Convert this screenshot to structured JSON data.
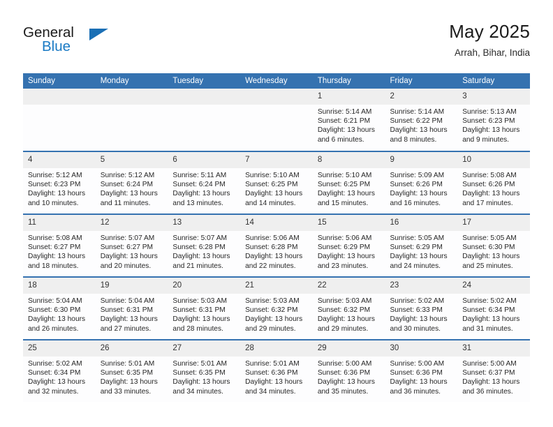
{
  "brand": {
    "name_part1": "General",
    "name_part2": "Blue",
    "triangle_color": "#1a6fb5",
    "blue_text_color": "#1a7ac4"
  },
  "header": {
    "title": "May 2025",
    "location": "Arrah, Bihar, India"
  },
  "theme": {
    "header_blue": "#3572b0",
    "daynum_band": "#efefef",
    "cell_background": "#fdfdfe",
    "text": "#262626"
  },
  "weekdays": [
    "Sunday",
    "Monday",
    "Tuesday",
    "Wednesday",
    "Thursday",
    "Friday",
    "Saturday"
  ],
  "weeks": [
    [
      {
        "day": "",
        "sunrise": "",
        "sunset": "",
        "daylight": ""
      },
      {
        "day": "",
        "sunrise": "",
        "sunset": "",
        "daylight": ""
      },
      {
        "day": "",
        "sunrise": "",
        "sunset": "",
        "daylight": ""
      },
      {
        "day": "",
        "sunrise": "",
        "sunset": "",
        "daylight": ""
      },
      {
        "day": "1",
        "sunrise": "Sunrise: 5:14 AM",
        "sunset": "Sunset: 6:21 PM",
        "daylight": "Daylight: 13 hours and 6 minutes."
      },
      {
        "day": "2",
        "sunrise": "Sunrise: 5:14 AM",
        "sunset": "Sunset: 6:22 PM",
        "daylight": "Daylight: 13 hours and 8 minutes."
      },
      {
        "day": "3",
        "sunrise": "Sunrise: 5:13 AM",
        "sunset": "Sunset: 6:23 PM",
        "daylight": "Daylight: 13 hours and 9 minutes."
      }
    ],
    [
      {
        "day": "4",
        "sunrise": "Sunrise: 5:12 AM",
        "sunset": "Sunset: 6:23 PM",
        "daylight": "Daylight: 13 hours and 10 minutes."
      },
      {
        "day": "5",
        "sunrise": "Sunrise: 5:12 AM",
        "sunset": "Sunset: 6:24 PM",
        "daylight": "Daylight: 13 hours and 11 minutes."
      },
      {
        "day": "6",
        "sunrise": "Sunrise: 5:11 AM",
        "sunset": "Sunset: 6:24 PM",
        "daylight": "Daylight: 13 hours and 13 minutes."
      },
      {
        "day": "7",
        "sunrise": "Sunrise: 5:10 AM",
        "sunset": "Sunset: 6:25 PM",
        "daylight": "Daylight: 13 hours and 14 minutes."
      },
      {
        "day": "8",
        "sunrise": "Sunrise: 5:10 AM",
        "sunset": "Sunset: 6:25 PM",
        "daylight": "Daylight: 13 hours and 15 minutes."
      },
      {
        "day": "9",
        "sunrise": "Sunrise: 5:09 AM",
        "sunset": "Sunset: 6:26 PM",
        "daylight": "Daylight: 13 hours and 16 minutes."
      },
      {
        "day": "10",
        "sunrise": "Sunrise: 5:08 AM",
        "sunset": "Sunset: 6:26 PM",
        "daylight": "Daylight: 13 hours and 17 minutes."
      }
    ],
    [
      {
        "day": "11",
        "sunrise": "Sunrise: 5:08 AM",
        "sunset": "Sunset: 6:27 PM",
        "daylight": "Daylight: 13 hours and 18 minutes."
      },
      {
        "day": "12",
        "sunrise": "Sunrise: 5:07 AM",
        "sunset": "Sunset: 6:27 PM",
        "daylight": "Daylight: 13 hours and 20 minutes."
      },
      {
        "day": "13",
        "sunrise": "Sunrise: 5:07 AM",
        "sunset": "Sunset: 6:28 PM",
        "daylight": "Daylight: 13 hours and 21 minutes."
      },
      {
        "day": "14",
        "sunrise": "Sunrise: 5:06 AM",
        "sunset": "Sunset: 6:28 PM",
        "daylight": "Daylight: 13 hours and 22 minutes."
      },
      {
        "day": "15",
        "sunrise": "Sunrise: 5:06 AM",
        "sunset": "Sunset: 6:29 PM",
        "daylight": "Daylight: 13 hours and 23 minutes."
      },
      {
        "day": "16",
        "sunrise": "Sunrise: 5:05 AM",
        "sunset": "Sunset: 6:29 PM",
        "daylight": "Daylight: 13 hours and 24 minutes."
      },
      {
        "day": "17",
        "sunrise": "Sunrise: 5:05 AM",
        "sunset": "Sunset: 6:30 PM",
        "daylight": "Daylight: 13 hours and 25 minutes."
      }
    ],
    [
      {
        "day": "18",
        "sunrise": "Sunrise: 5:04 AM",
        "sunset": "Sunset: 6:30 PM",
        "daylight": "Daylight: 13 hours and 26 minutes."
      },
      {
        "day": "19",
        "sunrise": "Sunrise: 5:04 AM",
        "sunset": "Sunset: 6:31 PM",
        "daylight": "Daylight: 13 hours and 27 minutes."
      },
      {
        "day": "20",
        "sunrise": "Sunrise: 5:03 AM",
        "sunset": "Sunset: 6:31 PM",
        "daylight": "Daylight: 13 hours and 28 minutes."
      },
      {
        "day": "21",
        "sunrise": "Sunrise: 5:03 AM",
        "sunset": "Sunset: 6:32 PM",
        "daylight": "Daylight: 13 hours and 29 minutes."
      },
      {
        "day": "22",
        "sunrise": "Sunrise: 5:03 AM",
        "sunset": "Sunset: 6:32 PM",
        "daylight": "Daylight: 13 hours and 29 minutes."
      },
      {
        "day": "23",
        "sunrise": "Sunrise: 5:02 AM",
        "sunset": "Sunset: 6:33 PM",
        "daylight": "Daylight: 13 hours and 30 minutes."
      },
      {
        "day": "24",
        "sunrise": "Sunrise: 5:02 AM",
        "sunset": "Sunset: 6:34 PM",
        "daylight": "Daylight: 13 hours and 31 minutes."
      }
    ],
    [
      {
        "day": "25",
        "sunrise": "Sunrise: 5:02 AM",
        "sunset": "Sunset: 6:34 PM",
        "daylight": "Daylight: 13 hours and 32 minutes."
      },
      {
        "day": "26",
        "sunrise": "Sunrise: 5:01 AM",
        "sunset": "Sunset: 6:35 PM",
        "daylight": "Daylight: 13 hours and 33 minutes."
      },
      {
        "day": "27",
        "sunrise": "Sunrise: 5:01 AM",
        "sunset": "Sunset: 6:35 PM",
        "daylight": "Daylight: 13 hours and 34 minutes."
      },
      {
        "day": "28",
        "sunrise": "Sunrise: 5:01 AM",
        "sunset": "Sunset: 6:36 PM",
        "daylight": "Daylight: 13 hours and 34 minutes."
      },
      {
        "day": "29",
        "sunrise": "Sunrise: 5:00 AM",
        "sunset": "Sunset: 6:36 PM",
        "daylight": "Daylight: 13 hours and 35 minutes."
      },
      {
        "day": "30",
        "sunrise": "Sunrise: 5:00 AM",
        "sunset": "Sunset: 6:36 PM",
        "daylight": "Daylight: 13 hours and 36 minutes."
      },
      {
        "day": "31",
        "sunrise": "Sunrise: 5:00 AM",
        "sunset": "Sunset: 6:37 PM",
        "daylight": "Daylight: 13 hours and 36 minutes."
      }
    ]
  ]
}
